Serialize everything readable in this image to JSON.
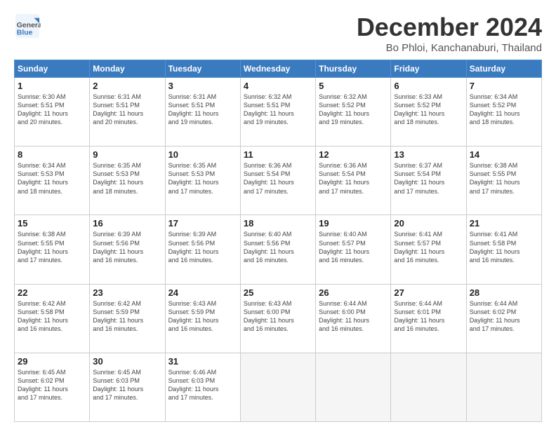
{
  "header": {
    "logo_general": "General",
    "logo_blue": "Blue",
    "month_title": "December 2024",
    "location": "Bo Phloi, Kanchanaburi, Thailand"
  },
  "days_of_week": [
    "Sunday",
    "Monday",
    "Tuesday",
    "Wednesday",
    "Thursday",
    "Friday",
    "Saturday"
  ],
  "weeks": [
    [
      {
        "day": "1",
        "info": "Sunrise: 6:30 AM\nSunset: 5:51 PM\nDaylight: 11 hours\nand 20 minutes."
      },
      {
        "day": "2",
        "info": "Sunrise: 6:31 AM\nSunset: 5:51 PM\nDaylight: 11 hours\nand 20 minutes."
      },
      {
        "day": "3",
        "info": "Sunrise: 6:31 AM\nSunset: 5:51 PM\nDaylight: 11 hours\nand 19 minutes."
      },
      {
        "day": "4",
        "info": "Sunrise: 6:32 AM\nSunset: 5:51 PM\nDaylight: 11 hours\nand 19 minutes."
      },
      {
        "day": "5",
        "info": "Sunrise: 6:32 AM\nSunset: 5:52 PM\nDaylight: 11 hours\nand 19 minutes."
      },
      {
        "day": "6",
        "info": "Sunrise: 6:33 AM\nSunset: 5:52 PM\nDaylight: 11 hours\nand 18 minutes."
      },
      {
        "day": "7",
        "info": "Sunrise: 6:34 AM\nSunset: 5:52 PM\nDaylight: 11 hours\nand 18 minutes."
      }
    ],
    [
      {
        "day": "8",
        "info": "Sunrise: 6:34 AM\nSunset: 5:53 PM\nDaylight: 11 hours\nand 18 minutes."
      },
      {
        "day": "9",
        "info": "Sunrise: 6:35 AM\nSunset: 5:53 PM\nDaylight: 11 hours\nand 18 minutes."
      },
      {
        "day": "10",
        "info": "Sunrise: 6:35 AM\nSunset: 5:53 PM\nDaylight: 11 hours\nand 17 minutes."
      },
      {
        "day": "11",
        "info": "Sunrise: 6:36 AM\nSunset: 5:54 PM\nDaylight: 11 hours\nand 17 minutes."
      },
      {
        "day": "12",
        "info": "Sunrise: 6:36 AM\nSunset: 5:54 PM\nDaylight: 11 hours\nand 17 minutes."
      },
      {
        "day": "13",
        "info": "Sunrise: 6:37 AM\nSunset: 5:54 PM\nDaylight: 11 hours\nand 17 minutes."
      },
      {
        "day": "14",
        "info": "Sunrise: 6:38 AM\nSunset: 5:55 PM\nDaylight: 11 hours\nand 17 minutes."
      }
    ],
    [
      {
        "day": "15",
        "info": "Sunrise: 6:38 AM\nSunset: 5:55 PM\nDaylight: 11 hours\nand 17 minutes."
      },
      {
        "day": "16",
        "info": "Sunrise: 6:39 AM\nSunset: 5:56 PM\nDaylight: 11 hours\nand 16 minutes."
      },
      {
        "day": "17",
        "info": "Sunrise: 6:39 AM\nSunset: 5:56 PM\nDaylight: 11 hours\nand 16 minutes."
      },
      {
        "day": "18",
        "info": "Sunrise: 6:40 AM\nSunset: 5:56 PM\nDaylight: 11 hours\nand 16 minutes."
      },
      {
        "day": "19",
        "info": "Sunrise: 6:40 AM\nSunset: 5:57 PM\nDaylight: 11 hours\nand 16 minutes."
      },
      {
        "day": "20",
        "info": "Sunrise: 6:41 AM\nSunset: 5:57 PM\nDaylight: 11 hours\nand 16 minutes."
      },
      {
        "day": "21",
        "info": "Sunrise: 6:41 AM\nSunset: 5:58 PM\nDaylight: 11 hours\nand 16 minutes."
      }
    ],
    [
      {
        "day": "22",
        "info": "Sunrise: 6:42 AM\nSunset: 5:58 PM\nDaylight: 11 hours\nand 16 minutes."
      },
      {
        "day": "23",
        "info": "Sunrise: 6:42 AM\nSunset: 5:59 PM\nDaylight: 11 hours\nand 16 minutes."
      },
      {
        "day": "24",
        "info": "Sunrise: 6:43 AM\nSunset: 5:59 PM\nDaylight: 11 hours\nand 16 minutes."
      },
      {
        "day": "25",
        "info": "Sunrise: 6:43 AM\nSunset: 6:00 PM\nDaylight: 11 hours\nand 16 minutes."
      },
      {
        "day": "26",
        "info": "Sunrise: 6:44 AM\nSunset: 6:00 PM\nDaylight: 11 hours\nand 16 minutes."
      },
      {
        "day": "27",
        "info": "Sunrise: 6:44 AM\nSunset: 6:01 PM\nDaylight: 11 hours\nand 16 minutes."
      },
      {
        "day": "28",
        "info": "Sunrise: 6:44 AM\nSunset: 6:02 PM\nDaylight: 11 hours\nand 17 minutes."
      }
    ],
    [
      {
        "day": "29",
        "info": "Sunrise: 6:45 AM\nSunset: 6:02 PM\nDaylight: 11 hours\nand 17 minutes."
      },
      {
        "day": "30",
        "info": "Sunrise: 6:45 AM\nSunset: 6:03 PM\nDaylight: 11 hours\nand 17 minutes."
      },
      {
        "day": "31",
        "info": "Sunrise: 6:46 AM\nSunset: 6:03 PM\nDaylight: 11 hours\nand 17 minutes."
      },
      null,
      null,
      null,
      null
    ]
  ]
}
